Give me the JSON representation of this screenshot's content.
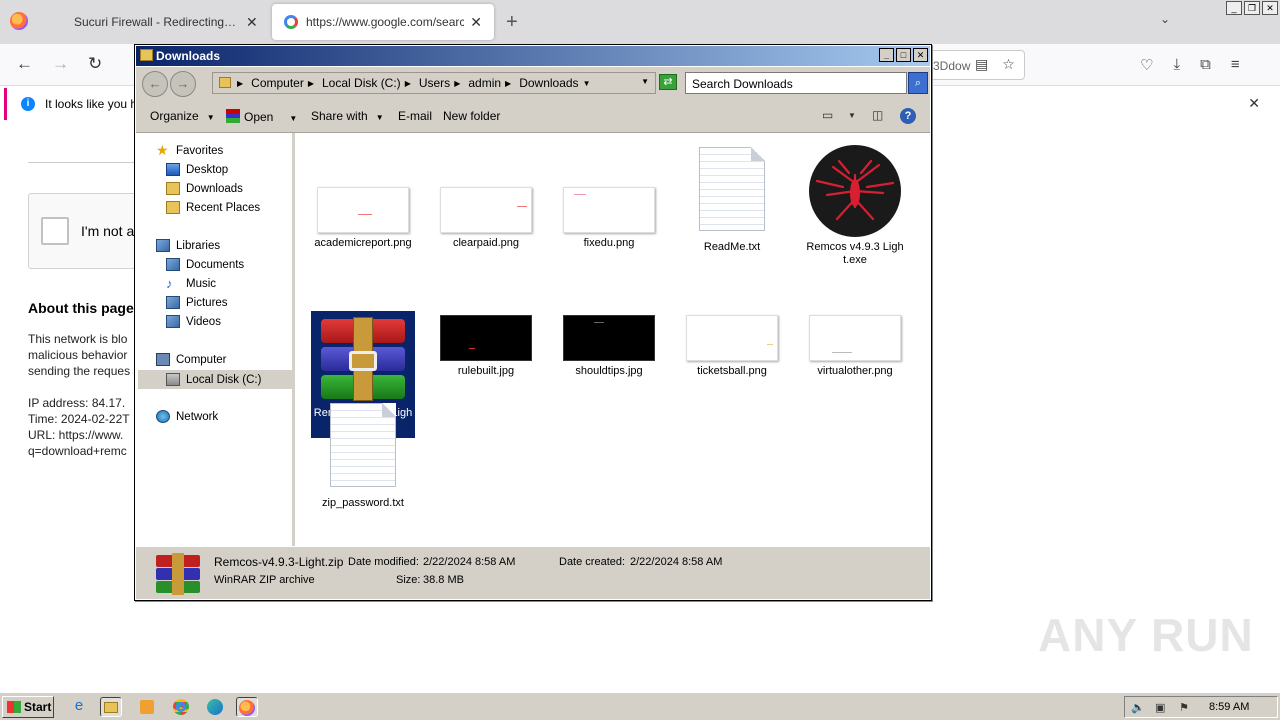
{
  "browser": {
    "tabs": [
      {
        "title": "Sucuri Firewall - Redirecting…",
        "active": false
      },
      {
        "title": "https://www.google.com/search?c",
        "active": true
      }
    ],
    "url_visible": "3Ddow",
    "notification": "It looks like you ha"
  },
  "page": {
    "captcha_label": "I'm not a",
    "about_heading": "About this page",
    "lines": [
      "This network is blo",
      "malicious behavior",
      "sending the reques",
      "IP address: 84.17.",
      "Time: 2024-02-22T",
      "URL: https://www.",
      "q=download+remc"
    ]
  },
  "explorer": {
    "title": "Downloads",
    "breadcrumbs": [
      "Computer",
      "Local Disk (C:)",
      "Users",
      "admin",
      "Downloads"
    ],
    "search_placeholder": "Search Downloads",
    "commands": {
      "organize": "Organize",
      "open": "Open",
      "share_with": "Share with",
      "email": "E-mail",
      "new_folder": "New folder"
    },
    "nav": {
      "favorites": "Favorites",
      "desktop": "Desktop",
      "downloads": "Downloads",
      "recent_places": "Recent Places",
      "libraries": "Libraries",
      "documents": "Documents",
      "music": "Music",
      "pictures": "Pictures",
      "videos": "Videos",
      "computer": "Computer",
      "local_disk": "Local Disk (C:)",
      "network": "Network"
    },
    "files": [
      {
        "name": "academicreport.png",
        "kind": "png-white"
      },
      {
        "name": "clearpaid.png",
        "kind": "png-white"
      },
      {
        "name": "fixedu.png",
        "kind": "png-white"
      },
      {
        "name": "ReadMe.txt",
        "kind": "txt"
      },
      {
        "name": "Remcos v4.9.3 Light.exe",
        "kind": "exe"
      },
      {
        "name": "Remcos-v4.9.3-Light.zip",
        "kind": "zip",
        "selected": true
      },
      {
        "name": "rulebuilt.jpg",
        "kind": "jpg-black"
      },
      {
        "name": "shouldtips.jpg",
        "kind": "jpg-black"
      },
      {
        "name": "ticketsball.png",
        "kind": "png-white"
      },
      {
        "name": "virtualother.png",
        "kind": "png-white"
      },
      {
        "name": "zip_password.txt",
        "kind": "txt"
      }
    ],
    "details": {
      "name": "Remcos-v4.9.3-Light.zip",
      "type": "WinRAR ZIP archive",
      "modified_label": "Date modified:",
      "modified": "2/22/2024 8:58 AM",
      "created_label": "Date created:",
      "created": "2/22/2024 8:58 AM",
      "size_label": "Size:",
      "size": "38.8 MB"
    }
  },
  "taskbar": {
    "start": "Start",
    "clock": "8:59 AM"
  },
  "watermark": "ANY RUN"
}
